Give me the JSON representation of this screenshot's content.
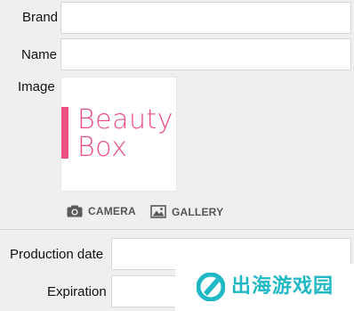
{
  "form": {
    "brand_label": "Brand",
    "brand_value": "",
    "name_label": "Name",
    "name_value": "",
    "image_label": "Image",
    "production_date_label": "Production date",
    "production_date_value": "",
    "expiration_label": "Expiration",
    "expiration_value": ""
  },
  "image": {
    "logo_line1": "Beauty",
    "logo_line2": "Box",
    "accent_color": "#ee4f81"
  },
  "actions": {
    "camera_label": "CAMERA",
    "camera_icon": "camera-icon",
    "gallery_label": "GALLERY",
    "gallery_icon": "image-icon"
  },
  "watermark": {
    "text": "出海游戏园",
    "color": "#1fb8c4"
  }
}
